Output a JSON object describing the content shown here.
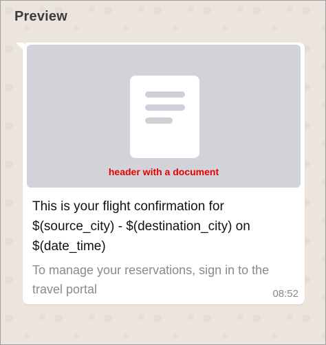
{
  "page": {
    "title": "Preview"
  },
  "message": {
    "header": {
      "icon": "document-icon",
      "caption": "header with a document",
      "caption_color": "#e60000"
    },
    "body": "This is your flight confirmation for $(source_city) - $(destination_city) on $(date_time)",
    "footer": "To manage your reservations, sign in to the travel portal",
    "timestamp": "08:52"
  }
}
